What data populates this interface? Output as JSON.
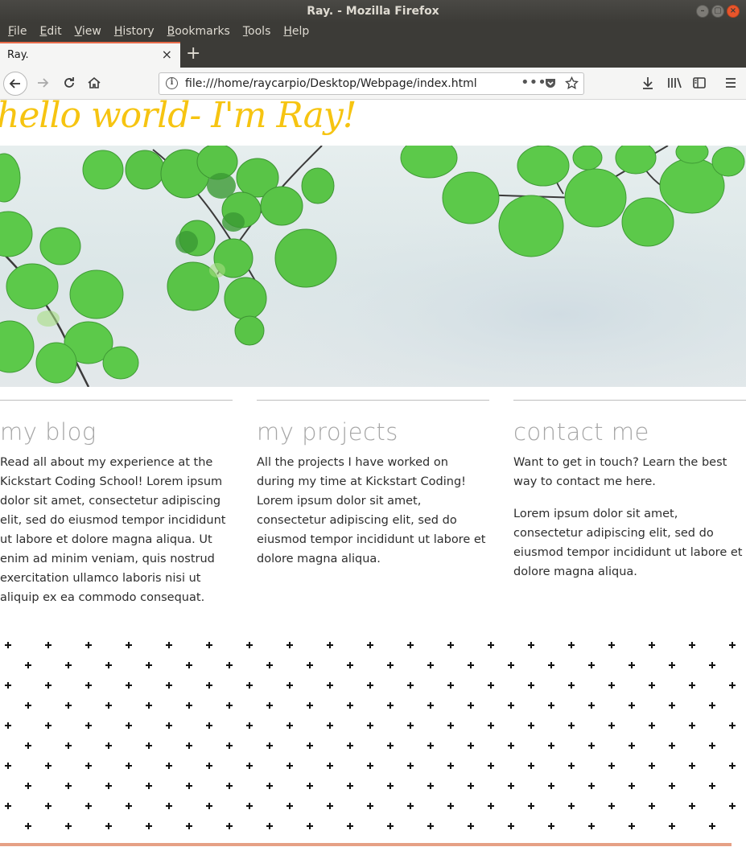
{
  "window": {
    "title": "Ray. - Mozilla Firefox"
  },
  "menu": [
    "File",
    "Edit",
    "View",
    "History",
    "Bookmarks",
    "Tools",
    "Help"
  ],
  "menu_mnemonics": [
    "F",
    "E",
    "V",
    "H",
    "B",
    "T",
    "H"
  ],
  "tab": {
    "title": "Ray.",
    "close_glyph": "×",
    "new_tab_glyph": "+"
  },
  "navbar": {
    "url": "file:///home/raycarpio/Desktop/Webpage/index.html",
    "icons": [
      "back-arrow-icon",
      "forward-arrow-icon",
      "reload-icon",
      "home-icon",
      "page-info-icon",
      "page-actions-icon",
      "pocket-icon",
      "bookmark-star-icon",
      "download-icon",
      "library-icon",
      "sidebar-icon",
      "hamburger-menu-icon"
    ]
  },
  "page": {
    "hero_title": "hello world- I'm Ray!",
    "hero_color": "#f6c411",
    "columns": [
      {
        "title": "my blog",
        "paragraphs": [
          "Read all about my experience at the Kickstart Coding School! Lorem ipsum dolor sit amet, consectetur adipiscing elit, sed do eiusmod tempor incididunt ut labore et dolore magna aliqua. Ut enim ad minim veniam, quis nostrud exercitation ullamco laboris nisi ut aliquip ex ea commodo consequat."
        ]
      },
      {
        "title": "my projects",
        "paragraphs": [
          "All the projects I have worked on during my time at Kickstart Coding! Lorem ipsum dolor sit amet, consectetur adipiscing elit, sed do eiusmod tempor incididunt ut labore et dolore magna aliqua."
        ]
      },
      {
        "title": "contact me",
        "paragraphs": [
          "Want to get in touch? Learn the best way to contact me here.",
          "Lorem ipsum dolor sit amet, consectetur adipiscing elit, sed do eiusmod tempor incididunt ut labore et dolore magna aliqua."
        ]
      }
    ]
  },
  "colors": {
    "chrome_dark": "#3c3b37",
    "tab_accent": "#e86c4a",
    "leaf_green": "#5cc94a",
    "sky": "#dbe6e7",
    "heading_grey": "#a6a6a6"
  }
}
